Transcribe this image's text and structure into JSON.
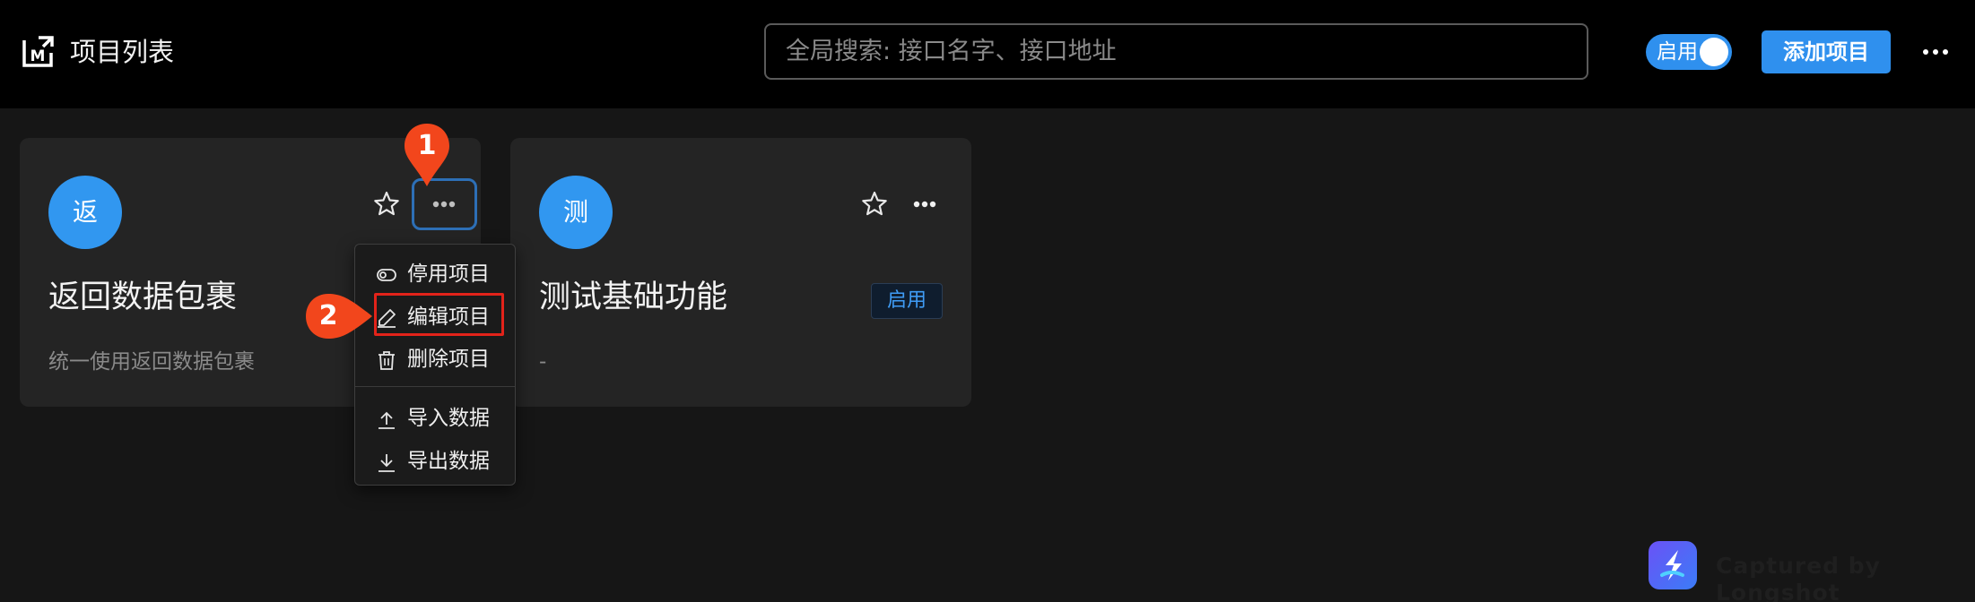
{
  "header": {
    "title": "项目列表",
    "search_placeholder": "全局搜索: 接口名字、接口地址",
    "toggle_label": "启用",
    "add_button": "添加项目"
  },
  "cards": [
    {
      "avatar_char": "返",
      "title": "返回数据包裹",
      "description": "统一使用返回数据包裹"
    },
    {
      "avatar_char": "测",
      "title": "测试基础功能",
      "description": "-",
      "status_badge": "启用"
    }
  ],
  "dropdown_menu": {
    "items": [
      {
        "label": "停用项目",
        "icon": "toggle-icon"
      },
      {
        "label": "编辑项目",
        "icon": "edit-pen-icon"
      },
      {
        "label": "删除项目",
        "icon": "trash-icon"
      },
      {
        "label": "导入数据",
        "icon": "upload-icon"
      },
      {
        "label": "导出数据",
        "icon": "download-icon"
      }
    ]
  },
  "step_markers": [
    "1",
    "2"
  ],
  "watermark": "Captured by Longshot",
  "colors": {
    "accent": "#2f90ee",
    "highlight": "#e2231a",
    "marker": "#f2461c"
  }
}
